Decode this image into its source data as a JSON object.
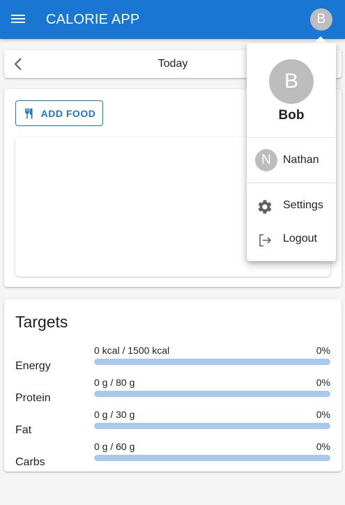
{
  "appbar": {
    "title": "CALORIE APP",
    "avatar_initial": "B",
    "menu_icon": "menu-icon"
  },
  "date_nav": {
    "label": "Today",
    "back_icon": "chevron-left-icon"
  },
  "diary": {
    "add_food_label": "ADD FOOD",
    "add_food_icon": "fork-knife-icon"
  },
  "targets": {
    "title": "Targets",
    "rows": [
      {
        "name": "Energy",
        "amount": "0 kcal / 1500 kcal",
        "percent": "0%",
        "progress": 0
      },
      {
        "name": "Protein",
        "amount": "0 g / 80 g",
        "percent": "0%",
        "progress": 0
      },
      {
        "name": "Fat",
        "amount": "0 g / 30 g",
        "percent": "0%",
        "progress": 0
      },
      {
        "name": "Carbs",
        "amount": "0 g / 60 g",
        "percent": "0%",
        "progress": 0
      }
    ]
  },
  "user_menu": {
    "avatar_initial": "B",
    "user_name": "Bob",
    "accounts": [
      {
        "initial": "N",
        "name": "Nathan"
      }
    ],
    "items": [
      {
        "label": "Settings",
        "icon": "gear-icon"
      },
      {
        "label": "Logout",
        "icon": "logout-icon"
      }
    ]
  },
  "colors": {
    "primary": "#1976d2",
    "progress_track": "#a8c8ec",
    "avatar_bg": "#bdbdbd",
    "background": "#f5f5f5"
  }
}
